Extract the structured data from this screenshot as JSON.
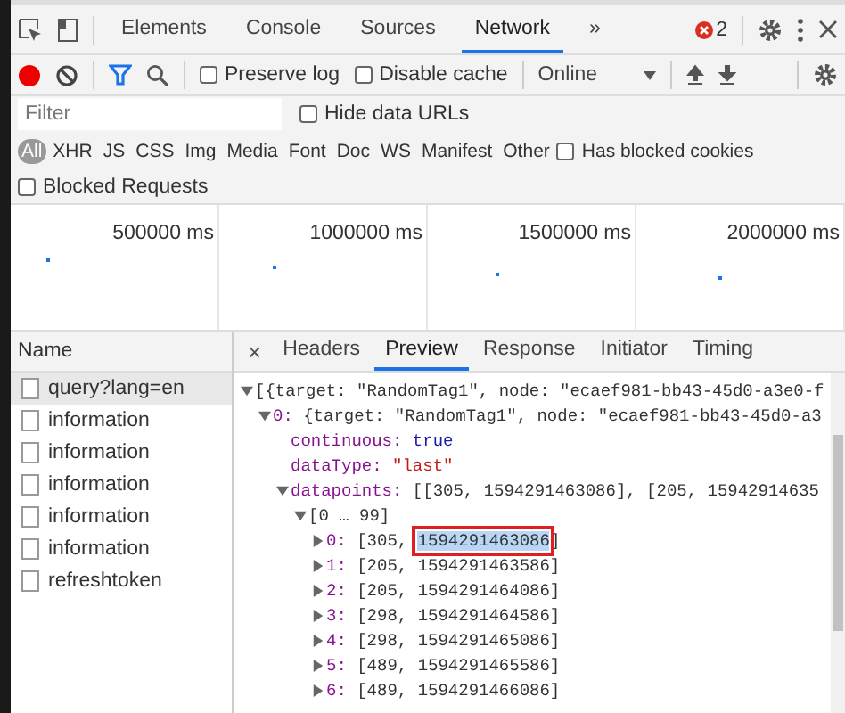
{
  "main_tabs": [
    {
      "label": "Elements",
      "selected": false
    },
    {
      "label": "Console",
      "selected": false
    },
    {
      "label": "Sources",
      "selected": false
    },
    {
      "label": "Network",
      "selected": true
    }
  ],
  "more_tabs": "»",
  "error_count": "2",
  "toolbar": {
    "recording": true,
    "preserve_log": {
      "label": "Preserve log",
      "checked": false
    },
    "disable_cache": {
      "label": "Disable cache",
      "checked": false
    },
    "throttling": "Online"
  },
  "filter": {
    "placeholder": "Filter",
    "hide_data_urls": {
      "label": "Hide data URLs",
      "checked": false
    }
  },
  "type_filters": [
    {
      "label": "All",
      "selected": true
    },
    {
      "label": "XHR",
      "selected": false
    },
    {
      "label": "JS",
      "selected": false
    },
    {
      "label": "CSS",
      "selected": false
    },
    {
      "label": "Img",
      "selected": false
    },
    {
      "label": "Media",
      "selected": false
    },
    {
      "label": "Font",
      "selected": false
    },
    {
      "label": "Doc",
      "selected": false
    },
    {
      "label": "WS",
      "selected": false
    },
    {
      "label": "Manifest",
      "selected": false
    },
    {
      "label": "Other",
      "selected": false
    }
  ],
  "has_blocked_cookies": {
    "label": "Has blocked cookies",
    "checked": false
  },
  "blocked_requests": {
    "label": "Blocked Requests",
    "checked": false
  },
  "overview": {
    "ticks": [
      "500000 ms",
      "1000000 ms",
      "1500000 ms",
      "2000000 ms"
    ]
  },
  "requests": {
    "header": "Name",
    "rows": [
      {
        "name": "query?lang=en",
        "selected": true
      },
      {
        "name": "information",
        "selected": false
      },
      {
        "name": "information",
        "selected": false
      },
      {
        "name": "information",
        "selected": false
      },
      {
        "name": "information",
        "selected": false
      },
      {
        "name": "information",
        "selected": false
      },
      {
        "name": "refreshtoken",
        "selected": false
      }
    ]
  },
  "detail_close": "×",
  "detail_tabs": [
    {
      "label": "Headers",
      "selected": false
    },
    {
      "label": "Preview",
      "selected": true
    },
    {
      "label": "Response",
      "selected": false
    },
    {
      "label": "Initiator",
      "selected": false
    },
    {
      "label": "Timing",
      "selected": false
    }
  ],
  "preview": [
    {
      "kind": "node",
      "expanded": true,
      "text": "[{target: \"RandomTag1\", node: \"ecaef981-bb43-45d0-a3e0-f",
      "children": [
        {
          "kind": "node",
          "expanded": true,
          "key": "0:",
          "text": "{target: \"RandomTag1\", node: \"ecaef981-bb43-45d0-a3",
          "children": [
            {
              "kind": "boolean",
              "key": "continuous:",
              "value": "true"
            },
            {
              "kind": "string",
              "key": "dataType:",
              "value": "\"last\""
            },
            {
              "kind": "node",
              "expanded": true,
              "key": "datapoints:",
              "text": "[[305, 1594291463086], [205, 15942914635",
              "children": [
                {
                  "kind": "node",
                  "expanded": true,
                  "text": "[0 … 99]",
                  "children": [
                    {
                      "kind": "node",
                      "expanded": false,
                      "key": "0:",
                      "text": "[305, ",
                      "selection": "1594291463086",
                      "text_end": "]",
                      "marked": true
                    },
                    {
                      "kind": "node",
                      "expanded": false,
                      "key": "1:",
                      "text": "[205, 1594291463586]"
                    },
                    {
                      "kind": "node",
                      "expanded": false,
                      "key": "2:",
                      "text": "[205, 1594291464086]"
                    },
                    {
                      "kind": "node",
                      "expanded": false,
                      "key": "3:",
                      "text": "[298, 1594291464586]"
                    },
                    {
                      "kind": "node",
                      "expanded": false,
                      "key": "4:",
                      "text": "[298, 1594291465086]"
                    },
                    {
                      "kind": "node",
                      "expanded": false,
                      "key": "5:",
                      "text": "[489, 1594291465586]"
                    },
                    {
                      "kind": "node",
                      "expanded": false,
                      "key": "6:",
                      "text": "[489, 1594291466086]"
                    }
                  ]
                }
              ]
            }
          ]
        }
      ]
    }
  ]
}
